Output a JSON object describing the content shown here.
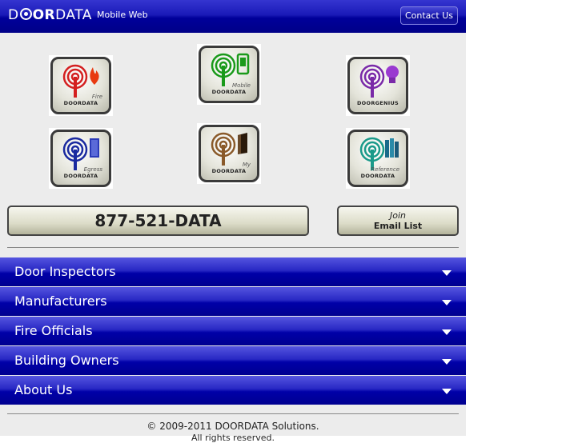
{
  "header": {
    "logo_left": "D",
    "logo_mid": "OR",
    "logo_right": "DATA",
    "subtitle": "Mobile Web",
    "contact_label": "Contact Us"
  },
  "apps": [
    {
      "name": "Fire",
      "brand": "DOORDATA",
      "color": "#d42020"
    },
    {
      "name": "Mobile",
      "brand": "DOORDATA",
      "color": "#1a9a1a"
    },
    {
      "name": "",
      "brand": "DOORGENIUS",
      "color": "#7a2aa8"
    },
    {
      "name": "Egress",
      "brand": "DOORDATA",
      "color": "#1a2aa0"
    },
    {
      "name": "My",
      "brand": "DOORDATA",
      "color": "#8a5a2a"
    },
    {
      "name": "Reference",
      "brand": "DOORDATA",
      "color": "#1a9a8a"
    }
  ],
  "phone": "877-521-DATA",
  "join": {
    "line1": "Join",
    "line2": "Email List"
  },
  "nav": [
    {
      "label": "Door Inspectors"
    },
    {
      "label": "Manufacturers"
    },
    {
      "label": "Fire Officials"
    },
    {
      "label": "Building Owners"
    },
    {
      "label": "About Us"
    }
  ],
  "footer": {
    "copyright": "© 2009-2011 DOORDATA Solutions.",
    "rights": "All rights reserved."
  }
}
